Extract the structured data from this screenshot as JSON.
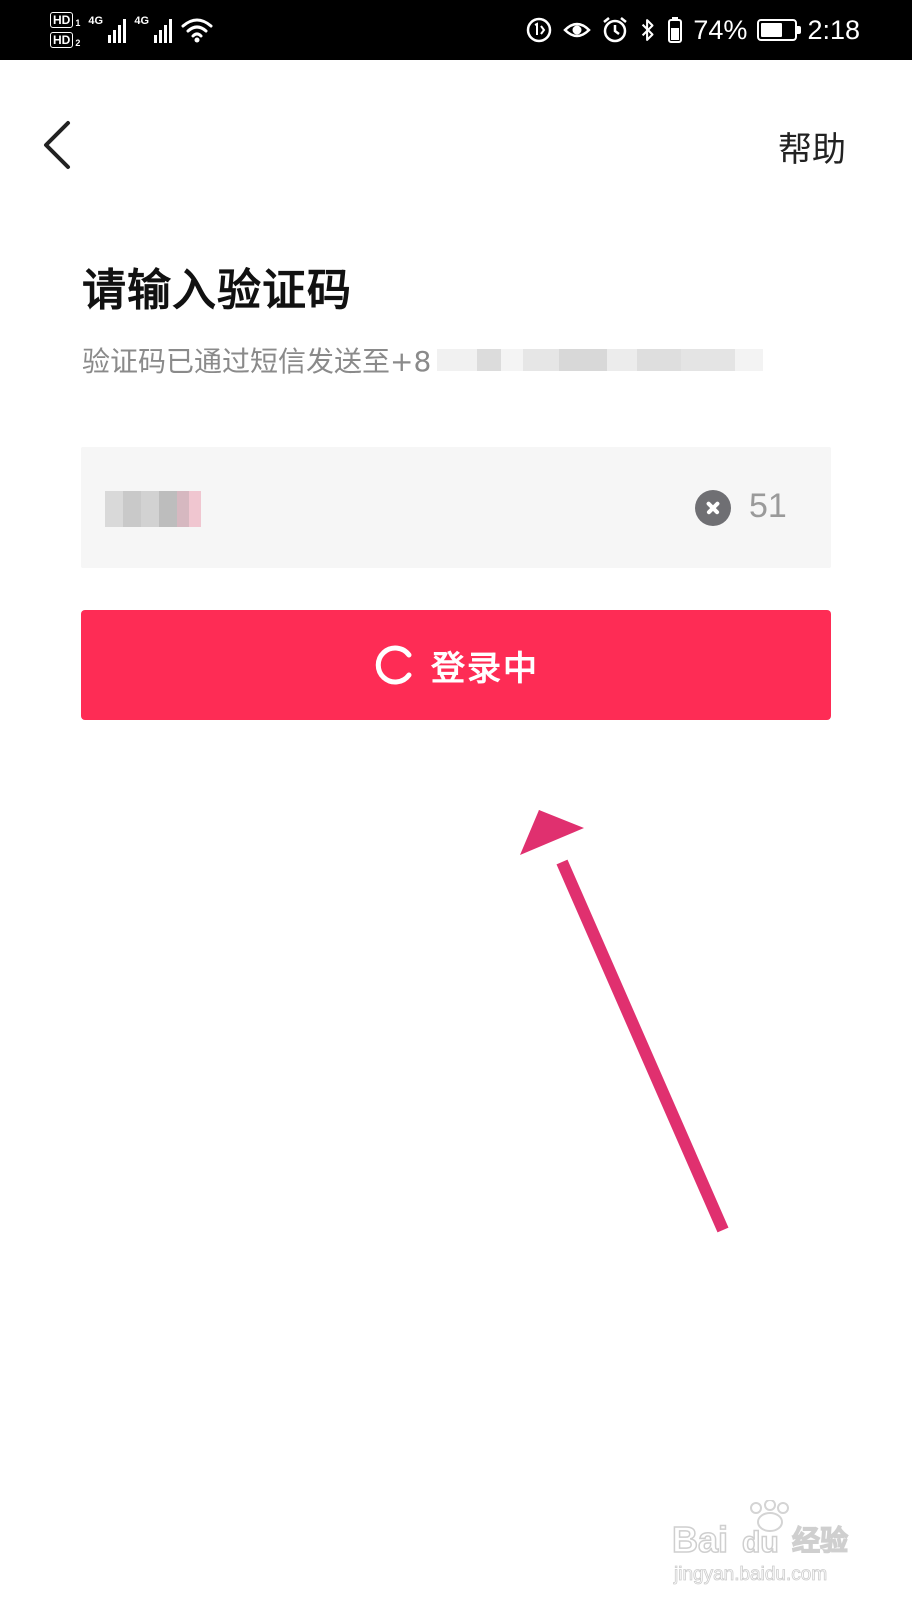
{
  "status_bar": {
    "hd1": "HD",
    "hd1_sub": "1",
    "hd2": "HD",
    "hd2_sub": "2",
    "network1": "4G",
    "network2": "4G",
    "battery_percent": "74%",
    "battery_level": 0.74,
    "time": "2:18",
    "icons": [
      "sim-data-icon",
      "eye-icon",
      "alarm-icon",
      "bluetooth-icon",
      "battery-icon"
    ]
  },
  "header": {
    "help": "帮助"
  },
  "page": {
    "title": "请输入验证码",
    "subtitle": "验证码已通过短信发送至+8"
  },
  "code_input": {
    "countdown": "51"
  },
  "login_button": {
    "label": "登录中"
  },
  "watermark": {
    "brand": "Bai",
    "brand2": "du",
    "brand_cn": "经验",
    "url": "jingyan.baidu.com"
  },
  "colors": {
    "accent": "#fe2c55",
    "annotation_arrow": "#e0306f",
    "input_bg": "#f6f6f6"
  }
}
